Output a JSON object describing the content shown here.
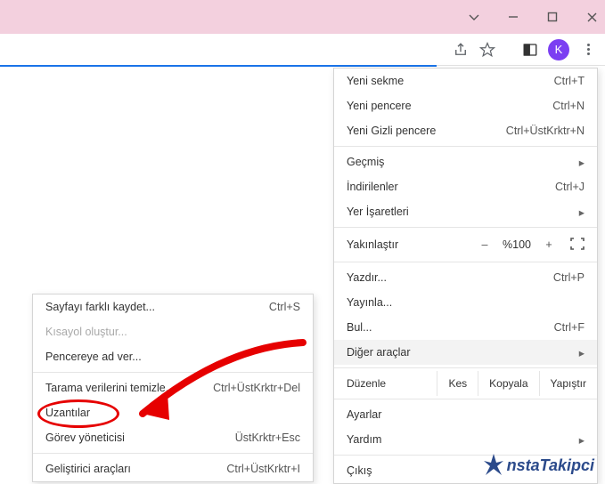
{
  "titlebar": {
    "tab_indicator": "V"
  },
  "avatar_letter": "K",
  "main_menu": {
    "new_tab": {
      "label": "Yeni sekme",
      "shortcut": "Ctrl+T"
    },
    "new_window": {
      "label": "Yeni pencere",
      "shortcut": "Ctrl+N"
    },
    "incognito": {
      "label": "Yeni Gizli pencere",
      "shortcut": "Ctrl+ÜstKrktr+N"
    },
    "history": {
      "label": "Geçmiş"
    },
    "downloads": {
      "label": "İndirilenler",
      "shortcut": "Ctrl+J"
    },
    "bookmarks": {
      "label": "Yer İşaretleri"
    },
    "zoom": {
      "label": "Yakınlaştır",
      "minus": "–",
      "level": "%100",
      "plus": "+"
    },
    "print": {
      "label": "Yazdır...",
      "shortcut": "Ctrl+P"
    },
    "cast": {
      "label": "Yayınla..."
    },
    "find": {
      "label": "Bul...",
      "shortcut": "Ctrl+F"
    },
    "more_tools": {
      "label": "Diğer araçlar"
    },
    "edit_label": "Düzenle",
    "cut": "Kes",
    "copy": "Kopyala",
    "paste": "Yapıştır",
    "settings": {
      "label": "Ayarlar"
    },
    "help": {
      "label": "Yardım"
    },
    "exit": {
      "label": "Çıkış"
    }
  },
  "sub_menu": {
    "save_as": {
      "label": "Sayfayı farklı kaydet...",
      "shortcut": "Ctrl+S"
    },
    "shortcut": {
      "label": "Kısayol oluştur..."
    },
    "name_window": {
      "label": "Pencereye ad ver..."
    },
    "clear_data": {
      "label": "Tarama verilerini temizle...",
      "shortcut": "Ctrl+ÜstKrktr+Del"
    },
    "extensions": {
      "label": "Uzantılar"
    },
    "task_manager": {
      "label": "Görev yöneticisi",
      "shortcut": "ÜstKrktr+Esc"
    },
    "dev_tools": {
      "label": "Geliştirici araçları",
      "shortcut": "Ctrl+ÜstKrktr+I"
    }
  },
  "watermark": "nstaTakipci"
}
